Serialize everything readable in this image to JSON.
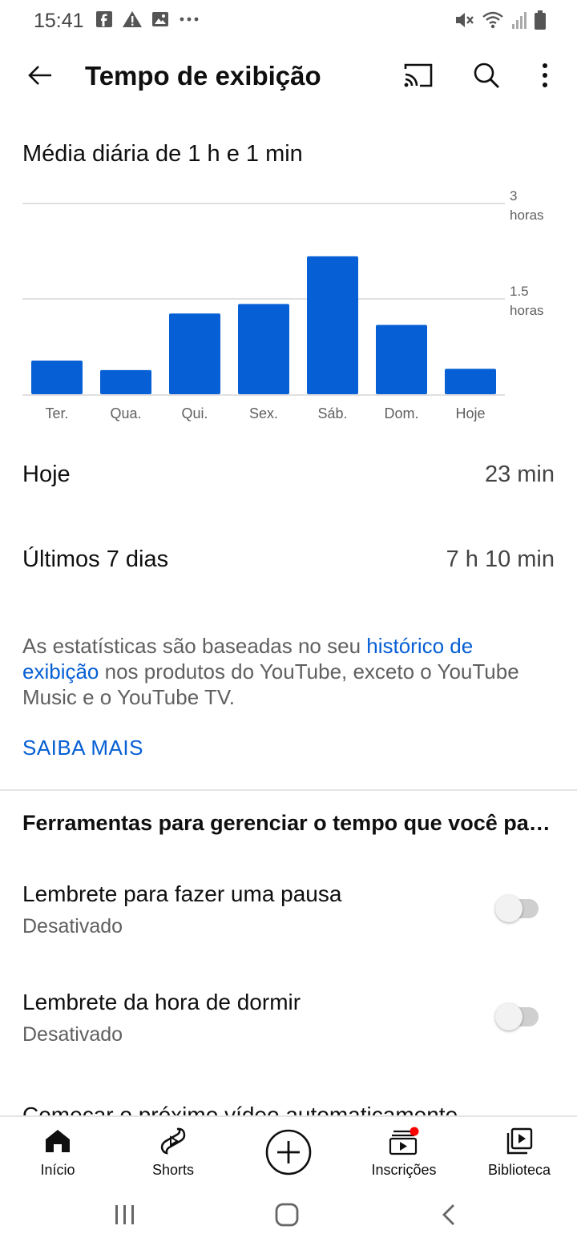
{
  "status_bar": {
    "time": "15:41",
    "left_icons": [
      "facebook-icon",
      "alert-icon",
      "image-icon",
      "more-dots-icon"
    ],
    "right_icons": [
      "mute-icon",
      "wifi-icon",
      "signal-icon",
      "battery-icon"
    ]
  },
  "header": {
    "title": "Tempo de exibição",
    "icons": [
      "back-arrow-icon",
      "cast-icon",
      "search-icon",
      "more-vert-icon"
    ]
  },
  "summary": {
    "average_label": "Média diária de 1 h e 1 min"
  },
  "chart_data": {
    "type": "bar",
    "categories": [
      "Ter.",
      "Qua.",
      "Qui.",
      "Sex.",
      "Sáb.",
      "Dom.",
      "Hoje"
    ],
    "values": [
      0.53,
      0.38,
      1.27,
      1.42,
      2.17,
      1.09,
      0.4
    ],
    "y_ticks": [
      {
        "value": 3,
        "label_line1": "3",
        "label_line2": "horas"
      },
      {
        "value": 1.5,
        "label_line1": "1.5",
        "label_line2": "horas"
      }
    ],
    "ylim": [
      0,
      3
    ],
    "bar_color": "#065fd4",
    "grid": true
  },
  "stats": {
    "today_label": "Hoje",
    "today_value": "23 min",
    "week_label": "Últimos 7 dias",
    "week_value": "7 h 10 min"
  },
  "info": {
    "text_before": "As estatísticas são baseadas no seu ",
    "link_text": "histórico de exibição",
    "text_after": " nos produtos do YouTube, exceto o YouTube Music e o YouTube TV.",
    "learn_more": "SAIBA MAIS"
  },
  "tools": {
    "heading": "Ferramentas para gerenciar o tempo que você passa assistindo",
    "settings": [
      {
        "title": "Lembrete para fazer uma pausa",
        "subtitle": "Desativado",
        "enabled": false
      },
      {
        "title": "Lembrete da hora de dormir",
        "subtitle": "Desativado",
        "enabled": false
      }
    ],
    "partial_item": "Começar o próximo vídeo automaticamente"
  },
  "bottom_nav": {
    "items": [
      {
        "label": "Início",
        "icon": "home-icon"
      },
      {
        "label": "Shorts",
        "icon": "shorts-icon"
      },
      {
        "label": "",
        "icon": "create-icon"
      },
      {
        "label": "Inscrições",
        "icon": "subscriptions-icon"
      },
      {
        "label": "Biblioteca",
        "icon": "library-icon"
      }
    ]
  },
  "colors": {
    "accent": "#065fd4",
    "notification_dot": "#ff0000",
    "text_primary": "#0f0f0f",
    "text_secondary": "#606060"
  }
}
